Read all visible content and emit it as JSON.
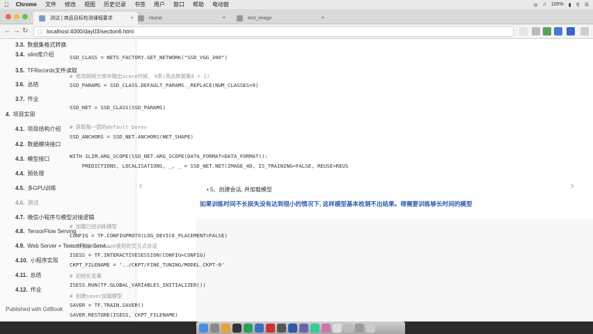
{
  "menubar": {
    "app": "Chrome",
    "items": [
      "文件",
      "修改",
      "视图",
      "历史记录",
      "书签",
      "用户",
      "窗口",
      "帮助",
      "电动窗"
    ],
    "battery": "100%",
    "right_icons": [
      "wifi-icon",
      "volume-icon",
      "search-icon",
      "menu-icon"
    ]
  },
  "tabs": [
    {
      "label": "测试 | 商品目标检测课程要求",
      "active": true
    },
    {
      "label": "Home",
      "active": false
    },
    {
      "label": "test_image",
      "active": false
    }
  ],
  "url": "localhost:4000/day03/section6.html",
  "sidebar": {
    "items": [
      {
        "num": "3.3.",
        "label": "数据集格式转换",
        "level": "sub"
      },
      {
        "num": "3.4.",
        "label": "slim库介绍",
        "level": "sub"
      },
      {
        "num": "3.5.",
        "label": "TFRecords文件读取",
        "level": "sub"
      },
      {
        "num": "3.6.",
        "label": "总结",
        "level": "sub"
      },
      {
        "num": "3.7.",
        "label": "作业",
        "level": "sub"
      },
      {
        "num": "4.",
        "label": "项目实现",
        "level": "top"
      },
      {
        "num": "4.1.",
        "label": "项目结构介绍",
        "level": "sub"
      },
      {
        "num": "4.2.",
        "label": "数据模块接口",
        "level": "sub"
      },
      {
        "num": "4.3.",
        "label": "模型接口",
        "level": "sub"
      },
      {
        "num": "4.4.",
        "label": "预处理",
        "level": "sub"
      },
      {
        "num": "4.5.",
        "label": "多GPU训练",
        "level": "sub"
      },
      {
        "num": "4.6.",
        "label": "测试",
        "level": "sub-dim"
      },
      {
        "num": "4.7.",
        "label": "微信小程序与模型对接逻辑",
        "level": "sub"
      },
      {
        "num": "4.8.",
        "label": "TensorFlow Serving",
        "level": "sub"
      },
      {
        "num": "4.9.",
        "label": "Web Server + TensorFlow Servi...",
        "level": "sub"
      },
      {
        "num": "4.10.",
        "label": "小程序实现",
        "level": "sub"
      },
      {
        "num": "4.11.",
        "label": "总结",
        "level": "sub"
      },
      {
        "num": "4.12.",
        "label": "作业",
        "level": "sub"
      }
    ],
    "footer": "Published with GitBook"
  },
  "content": {
    "code1": [
      {
        "text": "SSD_CLASS = NETS_FACTORY.GET_NETWORK(\"SSD_VGG_300\")",
        "type": "code"
      },
      {
        "text": "# 修改网络分类中输出score时候, 9类(商品数据集8 + 1)",
        "type": "comment"
      },
      {
        "text": "SSD_PARAMS = SSD_CLASS.DEFAULT_PARAMS._REPLACE(NUM_CLASSES=9)",
        "type": "code"
      },
      {
        "text": "SSD_NET = SSD_CLASS(SSD_PARAMS)",
        "type": "code"
      },
      {
        "text": "# 获取每一层的default boxes",
        "type": "comment"
      },
      {
        "text": "SSD_ANCHORS = SSD_NET.ANCHORS(NET_SHAPE)",
        "type": "code"
      },
      {
        "text": "WITH SLIM.ARG_SCOPE(SSD_NET.ARG_SCOPE(DATA_FORMAT=DATA_FORMAT)):",
        "type": "code"
      },
      {
        "text": "    PREDICTIONS, LOCALISATIONS, _, _ = SSD_NET.NET(IMAGE_4D, IS_TRAINING=FALSE, REUSE=REUS",
        "type": "code"
      }
    ],
    "bullet": "5、创建会话, 并加载模型",
    "notice": "如果训练时间不长损失没有达到很小的情况下, 这样模型基本检测不出结果。得需要训练够长时间的模型",
    "code2": [
      {
        "text": "# 加载已经训练模型",
        "type": "comment"
      },
      {
        "text": "CONFIG = TF.CONFIGPROTO(LOG_DEVICE_PLACEMENT=FALSE)",
        "type": "code"
      },
      {
        "text": "# 方便在Notebook使用的交互式会话",
        "type": "comment"
      },
      {
        "text": "ISESS = TF.INTERACTIVESESSION(CONFIG=CONFIG)",
        "type": "code"
      },
      {
        "text": "CKPT_FILENAME = '../CKPT/FINE_TUNING/MODEL.CKPT-0'",
        "type": "code"
      },
      {
        "text": "# 初始化变量",
        "type": "comment"
      },
      {
        "text": "ISESS.RUN(TF.GLOBAL_VARIABLES_INITIALIZER())",
        "type": "code"
      },
      {
        "text": "# 创建saver加载模型",
        "type": "comment"
      },
      {
        "text": "SAVER = TF.TRAIN.SAVER()",
        "type": "code"
      },
      {
        "text": "SAVER.RESTORE(ISESS, CKPT_FILENAME)",
        "type": "code"
      }
    ]
  },
  "colors": {
    "notice": "#2a5ab0",
    "comment": "#999999",
    "sidebar_bg": "#fafafa"
  }
}
